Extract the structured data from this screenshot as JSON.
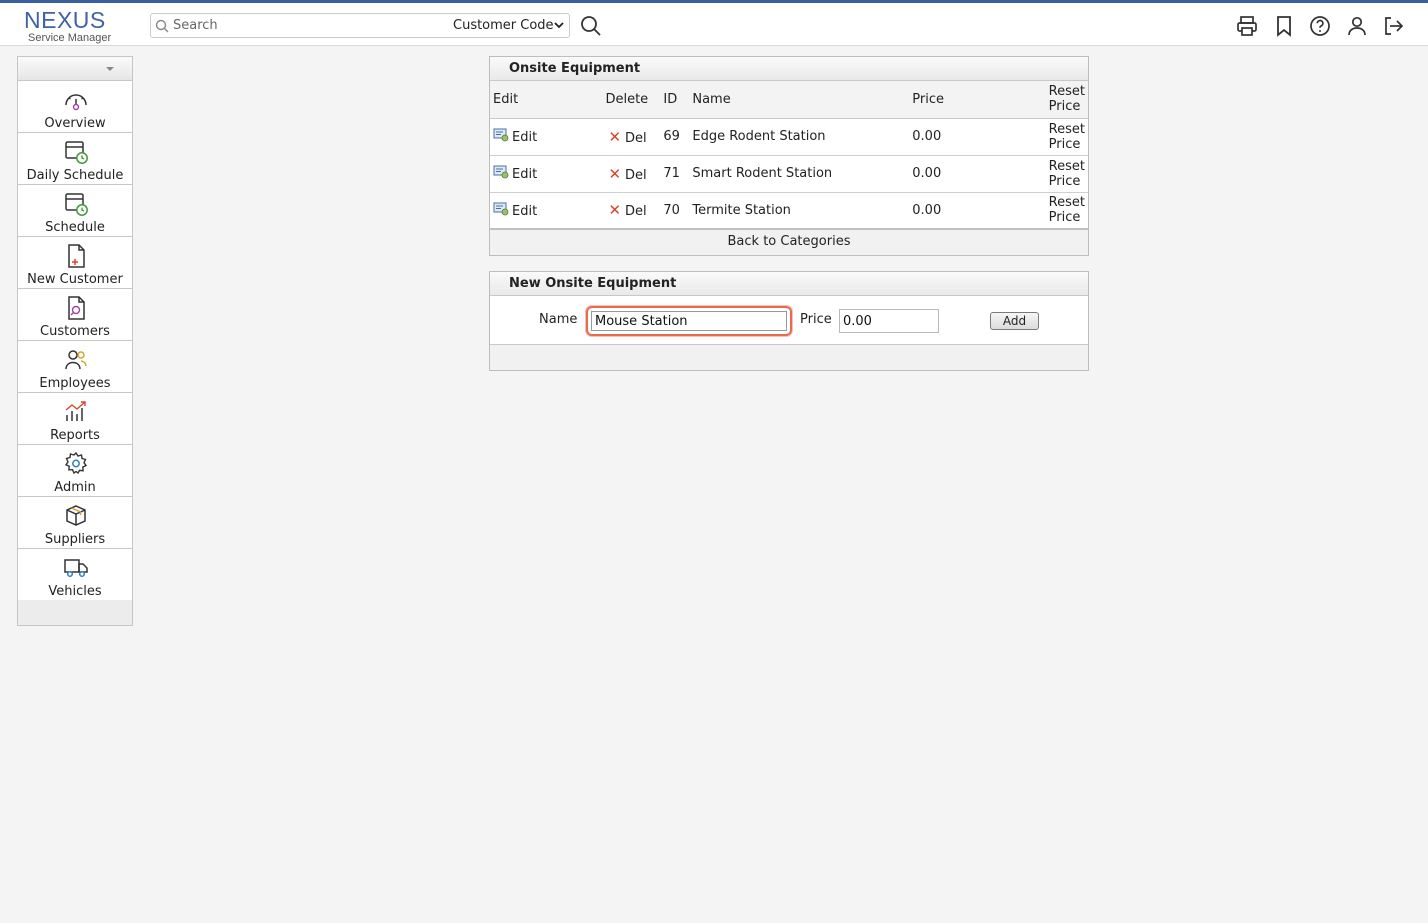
{
  "header": {
    "logo_main": "NEXUS",
    "logo_sub": "Service Manager",
    "search_placeholder": "Search",
    "search_scope": "Customer Code",
    "icons": [
      "printer-icon",
      "bookmark-icon",
      "help-icon",
      "user-icon",
      "logout-icon"
    ]
  },
  "sidebar": {
    "items": [
      {
        "label": "Overview",
        "icon": "gauge-icon"
      },
      {
        "label": "Daily Schedule",
        "icon": "calendar-clock-icon"
      },
      {
        "label": "Schedule",
        "icon": "calendar-clock-icon"
      },
      {
        "label": "New Customer",
        "icon": "file-plus-icon"
      },
      {
        "label": "Customers",
        "icon": "file-search-icon"
      },
      {
        "label": "Employees",
        "icon": "users-icon"
      },
      {
        "label": "Reports",
        "icon": "chart-icon"
      },
      {
        "label": "Admin",
        "icon": "gear-icon"
      },
      {
        "label": "Suppliers",
        "icon": "box-icon"
      },
      {
        "label": "Vehicles",
        "icon": "truck-icon"
      }
    ]
  },
  "equipment": {
    "title": "Onsite Equipment",
    "columns": {
      "edit": "Edit",
      "delete": "Delete",
      "id": "ID",
      "name": "Name",
      "price": "Price",
      "reset_line1": "Reset",
      "reset_line2": "Price"
    },
    "rows": [
      {
        "edit": "Edit",
        "del": "Del",
        "id": "69",
        "name": "Edge Rodent Station",
        "price": "0.00",
        "reset1": "Reset",
        "reset2": "Price"
      },
      {
        "edit": "Edit",
        "del": "Del",
        "id": "71",
        "name": "Smart Rodent Station",
        "price": "0.00",
        "reset1": "Reset",
        "reset2": "Price"
      },
      {
        "edit": "Edit",
        "del": "Del",
        "id": "70",
        "name": "Termite Station",
        "price": "0.00",
        "reset1": "Reset",
        "reset2": "Price"
      }
    ],
    "back_link": "Back to Categories"
  },
  "new_equipment": {
    "title": "New Onsite Equipment",
    "name_label": "Name",
    "name_value": "Mouse Station",
    "price_label": "Price",
    "price_value": "0.00",
    "add_label": "Add"
  },
  "colors": {
    "brand": "#3f63a6",
    "delete": "#d9442b",
    "focus": "#e86a4f"
  }
}
